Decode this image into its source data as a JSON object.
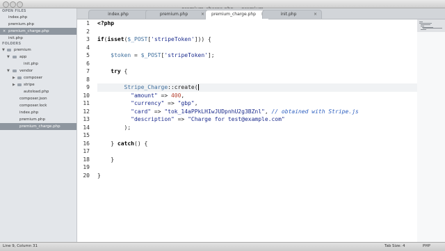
{
  "window": {
    "title": "premium_charge.php — premium"
  },
  "sidebar": {
    "open_files_header": "OPEN FILES",
    "open_files": [
      {
        "label": "index.php",
        "selected": false
      },
      {
        "label": "premium.php",
        "selected": false
      },
      {
        "label": "premium_charge.php",
        "selected": true
      },
      {
        "label": "init.php",
        "selected": false
      }
    ],
    "folders_header": "FOLDERS",
    "tree": [
      {
        "label": "premium",
        "type": "folder",
        "expanded": true,
        "depth": 0
      },
      {
        "label": "app",
        "type": "folder",
        "expanded": true,
        "depth": 1
      },
      {
        "label": "init.php",
        "type": "file",
        "depth": 2
      },
      {
        "label": "vendor",
        "type": "folder",
        "expanded": true,
        "depth": 1
      },
      {
        "label": "composer",
        "type": "folder",
        "expanded": false,
        "depth": 2
      },
      {
        "label": "stripe",
        "type": "folder",
        "expanded": false,
        "depth": 2
      },
      {
        "label": "autoload.php",
        "type": "file",
        "depth": 2
      },
      {
        "label": "composer.json",
        "type": "file",
        "depth": 1
      },
      {
        "label": "composer.lock",
        "type": "file",
        "depth": 1
      },
      {
        "label": "index.php",
        "type": "file",
        "depth": 1
      },
      {
        "label": "premium.php",
        "type": "file",
        "depth": 1
      },
      {
        "label": "premium_charge.php",
        "type": "file",
        "depth": 1,
        "selected": true
      }
    ]
  },
  "tabs": [
    {
      "label": "index.php",
      "active": false
    },
    {
      "label": "premium.php",
      "active": false
    },
    {
      "label": "premium_charge.php",
      "active": true
    },
    {
      "label": "init.php",
      "active": false
    }
  ],
  "editor": {
    "line_numbers": [
      "1",
      "2",
      "3",
      "4",
      "5",
      "6",
      "7",
      "8",
      "9",
      "10",
      "11",
      "12",
      "13",
      "14",
      "15",
      "16",
      "17",
      "18",
      "19",
      "20"
    ],
    "current_line": 9,
    "code": {
      "l1": "<?php",
      "l3_kw1": "if",
      "l3_kw2": "isset",
      "l3_var": "$_POST",
      "l3_str": "'stripeToken'",
      "l5_var1": "$token",
      "l5_var2": "$_POST",
      "l5_str": "'stripeToken'",
      "l7_kw": "try",
      "l9_cls": "Stripe_Charge",
      "l9_fn": "create",
      "l10_key": "\"amount\"",
      "l10_num": "400",
      "l11_key": "\"currency\"",
      "l11_val": "\"gbp\"",
      "l12_key": "\"card\"",
      "l12_val": "\"tok_14aPPkLHIwJUDpnhU2g3BZnl\"",
      "l12_comment": "// obtained with Stripe.js",
      "l13_key": "\"description\"",
      "l13_val": "\"Charge for test@example.com\"",
      "l14": ");",
      "l16_kw": "catch",
      "l18": "}",
      "l20": "}"
    }
  },
  "statusbar": {
    "position": "Line 9, Column 31",
    "tab_size": "Tab Size: 4",
    "language": "PHP"
  }
}
